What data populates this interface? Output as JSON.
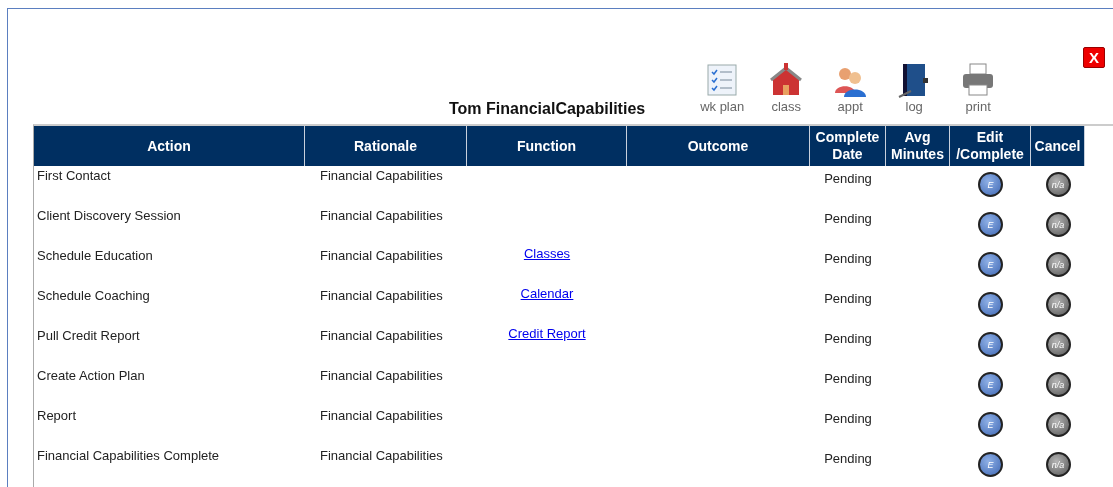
{
  "title": "Tom FinancialCapabilities",
  "toolbar": [
    {
      "kind": "plan",
      "label": "wk plan"
    },
    {
      "kind": "class",
      "label": "class"
    },
    {
      "kind": "appt",
      "label": "appt"
    },
    {
      "kind": "log",
      "label": "log"
    },
    {
      "kind": "print",
      "label": "print"
    }
  ],
  "close": {
    "label": "X"
  },
  "table": {
    "columns": [
      "Action",
      "Rationale",
      "Function",
      "Outcome",
      "Complete Date",
      "Avg Minutes",
      "Edit /Complete",
      "Cancel"
    ],
    "rows": [
      {
        "action": "First Contact",
        "rationale": "Financial Capabilities",
        "function": "",
        "date": "Pending",
        "edit": "E",
        "cancel": "n/a"
      },
      {
        "action": "Client Discovery Session",
        "rationale": "Financial Capabilities",
        "function": "",
        "date": "Pending",
        "edit": "E",
        "cancel": "n/a"
      },
      {
        "action": "Schedule Education",
        "rationale": "Financial Capabilities",
        "function": "Classes",
        "date": "Pending",
        "edit": "E",
        "cancel": "n/a"
      },
      {
        "action": "Schedule Coaching",
        "rationale": "Financial Capabilities",
        "function": "Calendar",
        "date": "Pending",
        "edit": "E",
        "cancel": "n/a"
      },
      {
        "action": "Pull Credit Report",
        "rationale": "Financial Capabilities",
        "function": "Credit Report",
        "date": "Pending",
        "edit": "E",
        "cancel": "n/a"
      },
      {
        "action": "Create Action Plan",
        "rationale": "Financial Capabilities",
        "function": "",
        "date": "Pending",
        "edit": "E",
        "cancel": "n/a"
      },
      {
        "action": "Report",
        "rationale": "Financial Capabilities",
        "function": "",
        "date": "Pending",
        "edit": "E",
        "cancel": "n/a"
      },
      {
        "action": "Financial Capabilities Complete",
        "rationale": "Financial Capabilities",
        "function": "",
        "date": "Pending",
        "edit": "E",
        "cancel": "n/a"
      }
    ]
  }
}
